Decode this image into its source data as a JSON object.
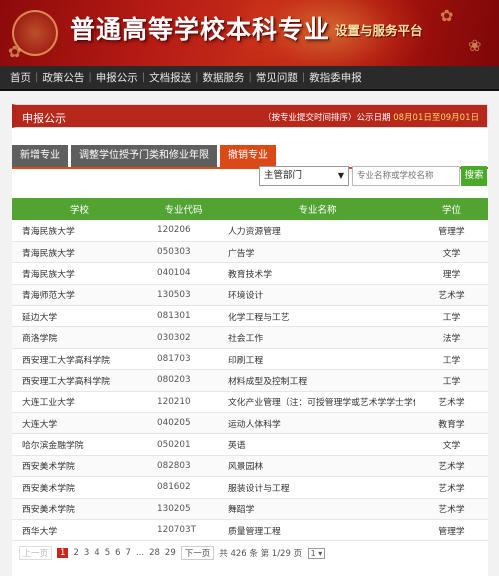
{
  "banner": {
    "title": "普通高等学校本科专业",
    "subtitle": "设置与服务平台"
  },
  "nav": [
    "首页",
    "政策公告",
    "申报公示",
    "文档报送",
    "数据服务",
    "常见问题",
    "教指委申报"
  ],
  "section": {
    "title": "申报公示",
    "note": "（按专业提交时间排序）公示日期",
    "date_range": "08月01日至09月01日"
  },
  "tabs": [
    {
      "label": "新增专业",
      "active": false
    },
    {
      "label": "调整学位授予门类和修业年限",
      "active": false
    },
    {
      "label": "撤销专业",
      "active": true
    }
  ],
  "filter": {
    "selected": "主管部门"
  },
  "search": {
    "placeholder": "专业名称或学校名称",
    "button": "搜索"
  },
  "table": {
    "headers": [
      "学校",
      "专业代码",
      "专业名称",
      "学位"
    ],
    "rows": [
      [
        "青海民族大学",
        "120206",
        "人力资源管理",
        "管理学"
      ],
      [
        "青海民族大学",
        "050303",
        "广告学",
        "文学"
      ],
      [
        "青海民族大学",
        "040104",
        "教育技术学",
        "理学"
      ],
      [
        "青海师范大学",
        "130503",
        "环境设计",
        "艺术学"
      ],
      [
        "延边大学",
        "081301",
        "化学工程与工艺",
        "工学"
      ],
      [
        "商洛学院",
        "030302",
        "社会工作",
        "法学"
      ],
      [
        "西安理工大学高科学院",
        "081703",
        "印刷工程",
        "工学"
      ],
      [
        "西安理工大学高科学院",
        "080203",
        "材料成型及控制工程",
        "工学"
      ],
      [
        "大连工业大学",
        "120210",
        "文化产业管理（注：可授管理学或艺术学学士学位）",
        "艺术学"
      ],
      [
        "大连大学",
        "040205",
        "运动人体科学",
        "教育学"
      ],
      [
        "哈尔滨金融学院",
        "050201",
        "英语",
        "文学"
      ],
      [
        "西安美术学院",
        "082803",
        "风景园林",
        "艺术学"
      ],
      [
        "西安美术学院",
        "081602",
        "服装设计与工程",
        "艺术学"
      ],
      [
        "西安美术学院",
        "130205",
        "舞蹈学",
        "艺术学"
      ],
      [
        "西华大学",
        "120703T",
        "质量管理工程",
        "管理学"
      ]
    ]
  },
  "pagination": {
    "prev": "上一页",
    "pages": [
      "1",
      "2",
      "3",
      "4",
      "5",
      "6",
      "7",
      "...",
      "28",
      "29"
    ],
    "current": "1",
    "next": "下一页",
    "total": "共 426 条 第 1/29 页",
    "page_select": "1"
  },
  "colors": {
    "banner_red": "#b51b14",
    "nav_bg": "#2a2a2a",
    "active_tab": "#d94a16",
    "table_header": "#51a332",
    "section_bar": "#b6271c"
  }
}
